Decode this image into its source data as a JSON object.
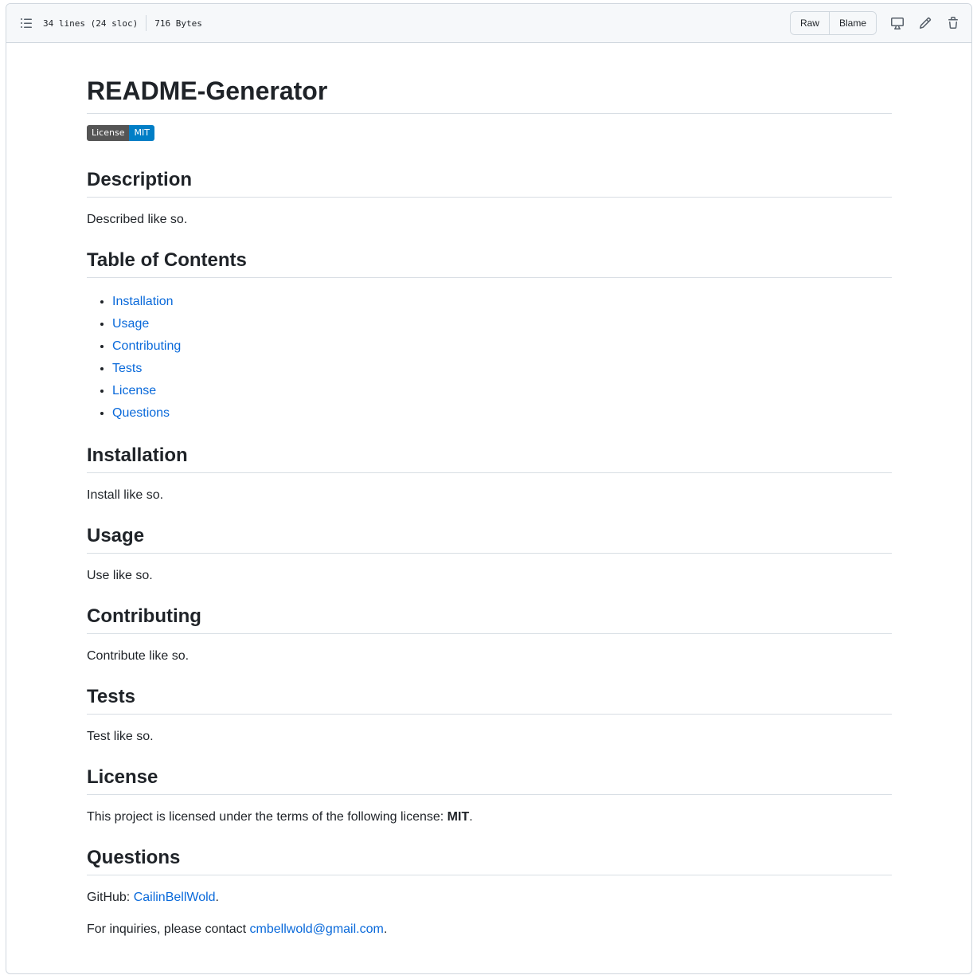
{
  "header": {
    "lines_info": "34 lines (24 sloc)",
    "size_info": "716 Bytes",
    "raw_label": "Raw",
    "blame_label": "Blame",
    "icons": [
      "list-unordered-icon",
      "desktop-icon",
      "pencil-icon",
      "trash-icon"
    ]
  },
  "readme": {
    "title": "README-Generator",
    "badge": {
      "label": "License",
      "value": "MIT"
    },
    "description": {
      "heading": "Description",
      "text": "Described like so."
    },
    "toc": {
      "heading": "Table of Contents",
      "items": [
        "Installation",
        "Usage",
        "Contributing",
        "Tests",
        "License",
        "Questions"
      ]
    },
    "installation": {
      "heading": "Installation",
      "text": "Install like so."
    },
    "usage": {
      "heading": "Usage",
      "text": "Use like so."
    },
    "contributing": {
      "heading": "Contributing",
      "text": "Contribute like so."
    },
    "tests": {
      "heading": "Tests",
      "text": "Test like so."
    },
    "license": {
      "heading": "License",
      "text_prefix": "This project is licensed under the terms of the following license: ",
      "name": "MIT",
      "text_suffix": "."
    },
    "questions": {
      "heading": "Questions",
      "github_prefix": "GitHub: ",
      "github_user": "CailinBellWold",
      "github_suffix": ".",
      "contact_prefix": "For inquiries, please contact ",
      "email": "cmbellwold@gmail.com",
      "contact_suffix": "."
    }
  },
  "colors": {
    "link": "#0969da",
    "badge_left": "#555555",
    "badge_right": "#007ec6"
  }
}
